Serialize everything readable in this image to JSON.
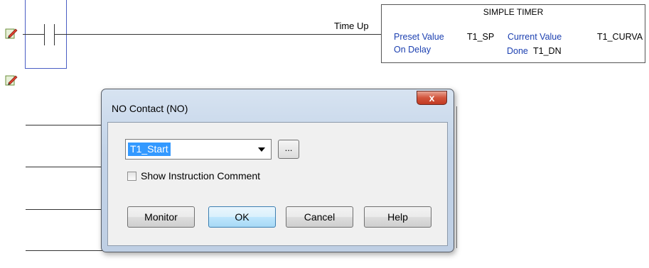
{
  "rung": {
    "coil_label": "Time Up"
  },
  "timer_block": {
    "title": "SIMPLE TIMER",
    "preset_label": "Preset Value",
    "preset_tag": "T1_SP",
    "current_label": "Current Value",
    "current_tag": "T1_CURVA",
    "mode_label": "On Delay",
    "done_label": "Done",
    "done_tag": "T1_DN"
  },
  "dialog": {
    "title": "NO Contact (NO)",
    "close_glyph": "x",
    "tag_value": "T1_Start",
    "browse_label": "...",
    "checkbox_label": "Show Instruction Comment",
    "checkbox_checked": false,
    "buttons": {
      "monitor": "Monitor",
      "ok": "OK",
      "cancel": "Cancel",
      "help": "Help"
    }
  },
  "colors": {
    "selection_border": "#4a5ec4",
    "timer_blue_text": "#1b3fb0",
    "close_red": "#c13a22",
    "combo_highlight": "#3399ff"
  },
  "icons": [
    "edit-rung-icon",
    "chevron-down-icon",
    "close-icon"
  ]
}
